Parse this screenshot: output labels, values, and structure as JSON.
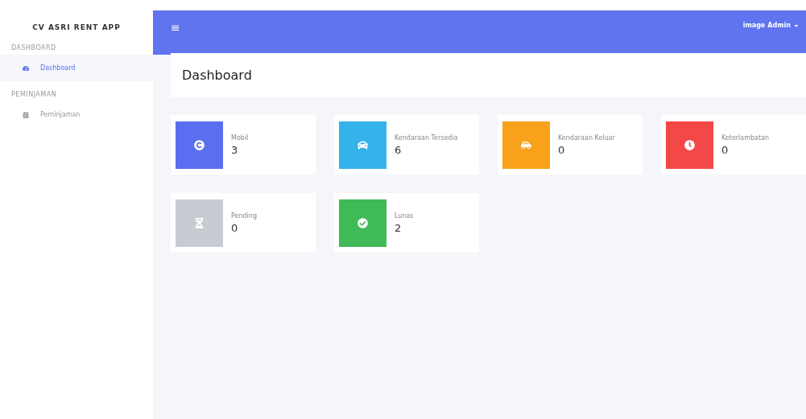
{
  "sidebar": {
    "brand": "CV ASRI RENT APP",
    "sections": [
      {
        "heading": "DASHBOARD",
        "items": [
          {
            "label": "Dashboard",
            "selected": true
          }
        ]
      },
      {
        "heading": "PEMINJAMAN",
        "items": [
          {
            "label": "Peminjaman",
            "selected": false
          }
        ]
      }
    ]
  },
  "topbar": {
    "menu_icon": "≡",
    "image_alt": "image",
    "user": "Admin"
  },
  "page_title": "Dashboard",
  "cards": [
    {
      "label": "Mobil",
      "value": "3",
      "color": "#5a6ff0"
    },
    {
      "label": "Kendaraan Tersedia",
      "value": "6",
      "color": "#35b2ea"
    },
    {
      "label": "Kendaraan Keluar",
      "value": "0",
      "color": "#f9a11b"
    },
    {
      "label": "Keterlambatan",
      "value": "0",
      "color": "#f44848"
    },
    {
      "label": "Pending",
      "value": "0",
      "color": "#c8ccd2"
    },
    {
      "label": "Lunas",
      "value": "2",
      "color": "#3fba57"
    }
  ]
}
